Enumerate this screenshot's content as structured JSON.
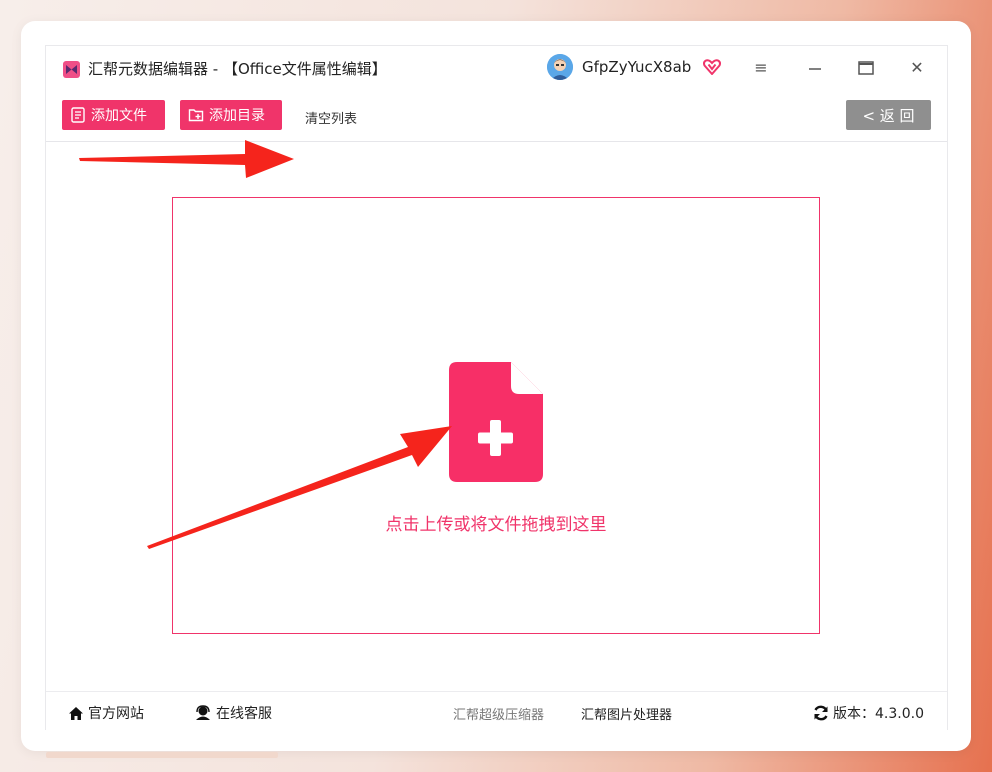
{
  "app": {
    "title": "汇帮元数据编辑器 - 【Office文件属性编辑】",
    "username": "GfpZyYucX8ab",
    "logo_icon": "bowtie-logo-icon",
    "accent_color": "#f0346a"
  },
  "window_controls": {
    "menu": "≡",
    "minimize": "—",
    "close": "✕"
  },
  "toolbar": {
    "add_file": "添加文件",
    "add_dir": "添加目录",
    "clear_list": "清空列表",
    "back": "< 返 回"
  },
  "drop_zone": {
    "text": "点击上传或将文件拖拽到这里",
    "icon": "file-plus-icon"
  },
  "footer": {
    "official_site": "官方网站",
    "online_service": "在线客服",
    "compressor": "汇帮超级压缩器",
    "image_processor": "汇帮图片处理器",
    "version": "版本：4.3.0.0"
  }
}
